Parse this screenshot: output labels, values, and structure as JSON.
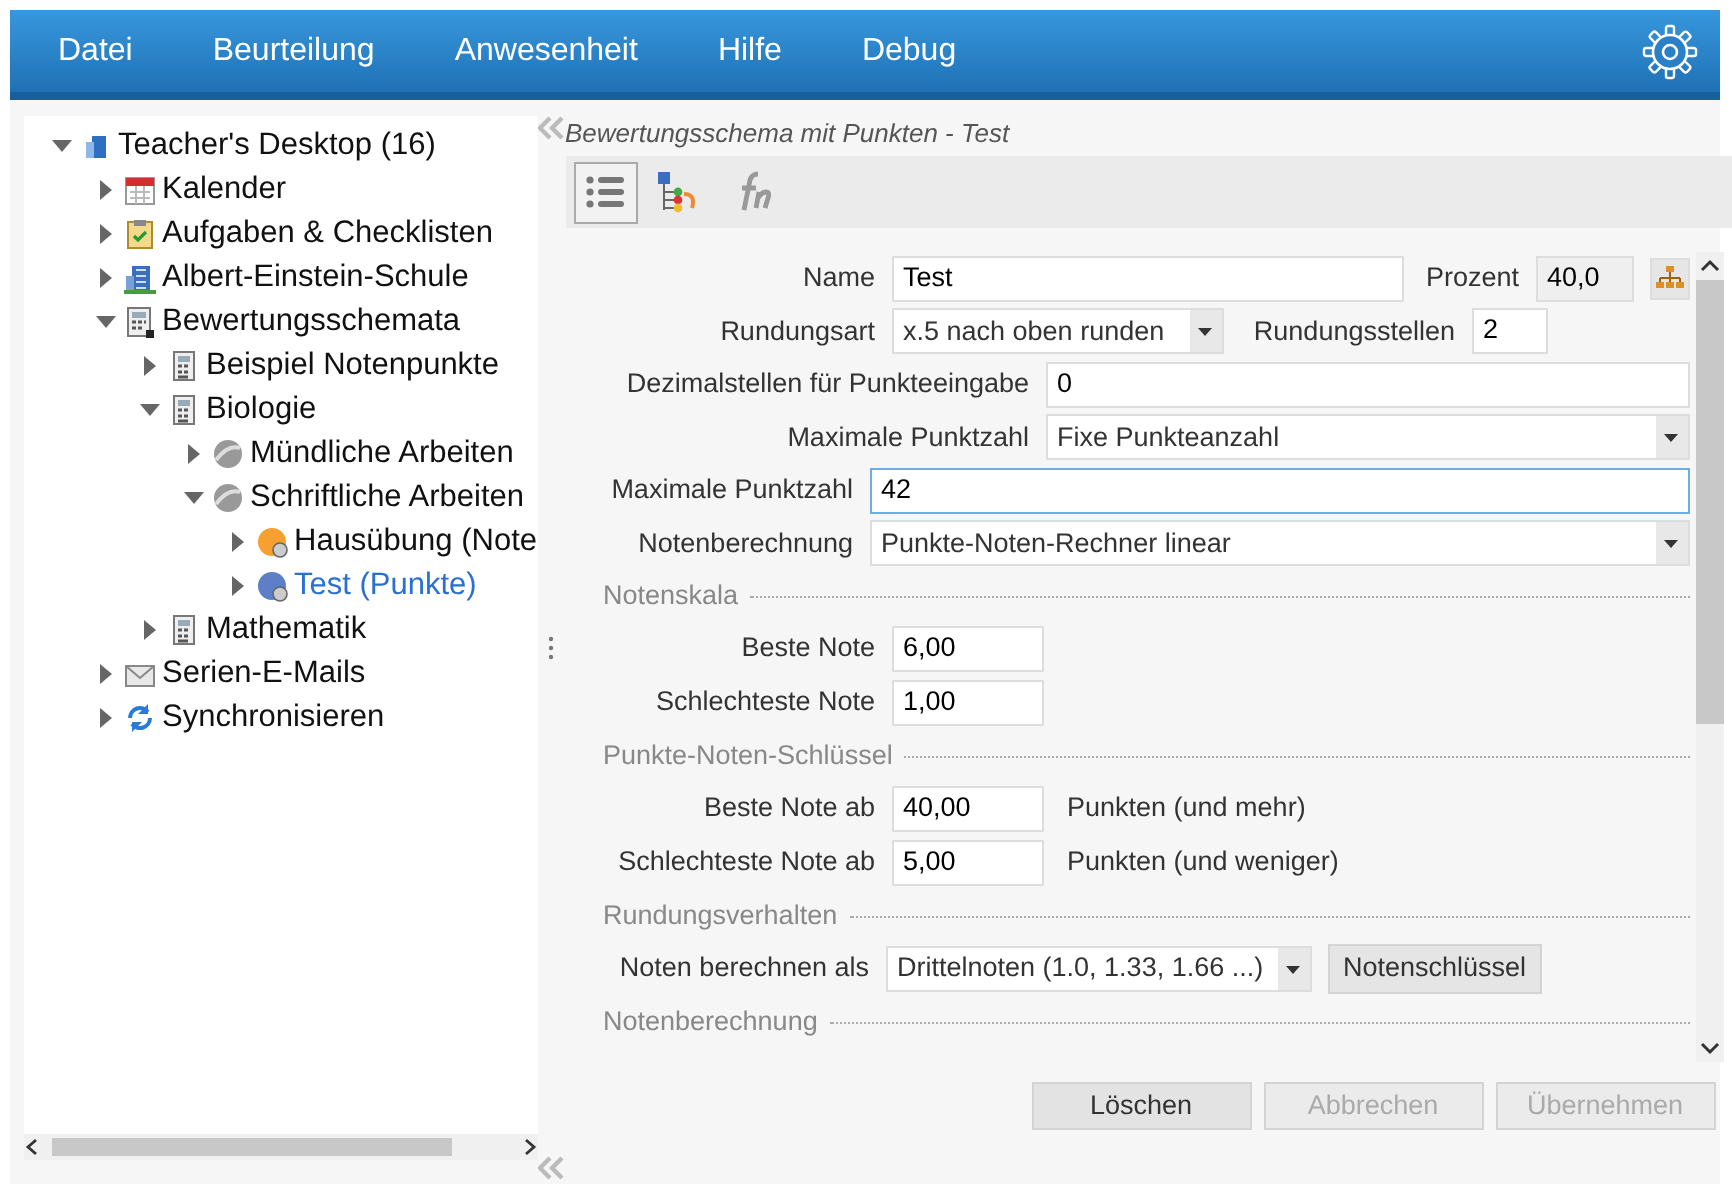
{
  "menu": [
    {
      "label": "Datei"
    },
    {
      "label": "Beurteilung"
    },
    {
      "label": "Anwesenheit"
    },
    {
      "label": "Hilfe"
    },
    {
      "label": "Debug"
    }
  ],
  "tree": [
    {
      "label": "Teacher's Desktop (16)",
      "kind": "desktop",
      "expanded": true,
      "selected": false,
      "children": [
        {
          "label": "Kalender",
          "kind": "calendar",
          "expanded": false,
          "selected": false
        },
        {
          "label": "Aufgaben & Checklisten",
          "kind": "clipboard",
          "expanded": false,
          "selected": false
        },
        {
          "label": "Albert-Einstein-Schule",
          "kind": "building",
          "expanded": false,
          "selected": false
        },
        {
          "label": "Bewertungsschemata",
          "kind": "calculator-folder",
          "expanded": true,
          "selected": false,
          "children": [
            {
              "label": "Beispiel Notenpunkte",
              "kind": "calculator",
              "expanded": false,
              "selected": false
            },
            {
              "label": "Biologie",
              "kind": "calculator",
              "expanded": true,
              "selected": false,
              "children": [
                {
                  "label": "Mündliche Arbeiten",
                  "kind": "sphere",
                  "expanded": false,
                  "selected": false
                },
                {
                  "label": "Schriftliche Arbeiten",
                  "kind": "sphere",
                  "expanded": true,
                  "selected": false,
                  "children": [
                    {
                      "label": "Hausübung (Note",
                      "kind": "orange-pie",
                      "expanded": false,
                      "selected": false
                    },
                    {
                      "label": "Test (Punkte)",
                      "kind": "blue-pie",
                      "expanded": false,
                      "selected": true
                    }
                  ]
                }
              ]
            },
            {
              "label": "Mathematik",
              "kind": "calculator",
              "expanded": false,
              "selected": false
            }
          ]
        },
        {
          "label": "Serien-E-Mails",
          "kind": "envelope",
          "expanded": false,
          "selected": false
        },
        {
          "label": "Synchronisieren",
          "kind": "sync",
          "expanded": false,
          "selected": false
        }
      ]
    }
  ],
  "panel": {
    "title": "Bewertungsschema mit Punkten - Test",
    "toolbar": [
      {
        "kind": "list",
        "selected": true
      },
      {
        "kind": "hierarchy",
        "selected": false
      },
      {
        "kind": "function",
        "selected": false
      }
    ],
    "rows": [
      {
        "items": [
          {
            "kind": "label",
            "text": "Name"
          },
          {
            "kind": "input",
            "value": "Test",
            "focused": false
          },
          {
            "kind": "label",
            "text": "Prozent"
          },
          {
            "kind": "readonly",
            "value": "40,0"
          },
          {
            "kind": "tree-button"
          }
        ]
      },
      {
        "items": [
          {
            "kind": "label",
            "text": "Rundungsart"
          },
          {
            "kind": "select",
            "value": "x.5 nach oben runden"
          },
          {
            "kind": "label",
            "text": "Rundungsstellen"
          },
          {
            "kind": "input",
            "value": "2",
            "focused": false
          }
        ]
      },
      {
        "items": [
          {
            "kind": "label",
            "text": "Dezimalstellen für Punkteeingabe"
          },
          {
            "kind": "input",
            "value": "0",
            "focused": false
          }
        ]
      },
      {
        "items": [
          {
            "kind": "label",
            "text": "Maximale Punktzahl"
          },
          {
            "kind": "select",
            "value": "Fixe Punkteanzahl"
          }
        ]
      },
      {
        "items": [
          {
            "kind": "label",
            "text": "Maximale Punktzahl"
          },
          {
            "kind": "input",
            "value": "42",
            "focused": true
          }
        ]
      },
      {
        "items": [
          {
            "kind": "label",
            "text": "Notenberechnung"
          },
          {
            "kind": "select",
            "value": "Punkte-Noten-Rechner linear"
          }
        ]
      }
    ],
    "sections": [
      {
        "title": "Notenskala",
        "rows": [
          {
            "items": [
              {
                "kind": "label",
                "text": "Beste Note"
              },
              {
                "kind": "input",
                "value": "6,00",
                "focused": false
              }
            ]
          },
          {
            "items": [
              {
                "kind": "label",
                "text": "Schlechteste Note"
              },
              {
                "kind": "input",
                "value": "1,00",
                "focused": false
              }
            ]
          }
        ]
      },
      {
        "title": "Punkte-Noten-Schlüssel",
        "rows": [
          {
            "items": [
              {
                "kind": "label",
                "text": "Beste Note ab"
              },
              {
                "kind": "input",
                "value": "40,00",
                "focused": false
              },
              {
                "kind": "suffix",
                "text": "Punkten (und mehr)"
              }
            ]
          },
          {
            "items": [
              {
                "kind": "label",
                "text": "Schlechteste Note ab"
              },
              {
                "kind": "input",
                "value": "5,00",
                "focused": false
              },
              {
                "kind": "suffix",
                "text": "Punkten (und weniger)"
              }
            ]
          }
        ]
      },
      {
        "title": "Rundungsverhalten",
        "rows": [
          {
            "items": [
              {
                "kind": "label",
                "text": "Noten berechnen als"
              },
              {
                "kind": "select",
                "value": "Drittelnoten (1.0, 1.33, 1.66 ...)"
              },
              {
                "kind": "button",
                "text": "Notenschlüssel"
              }
            ]
          }
        ]
      },
      {
        "title": "Notenberechnung"
      }
    ],
    "buttons": [
      {
        "label": "Löschen",
        "disabled": false
      },
      {
        "label": "Abbrechen",
        "disabled": true
      },
      {
        "label": "Übernehmen",
        "disabled": true
      }
    ]
  }
}
